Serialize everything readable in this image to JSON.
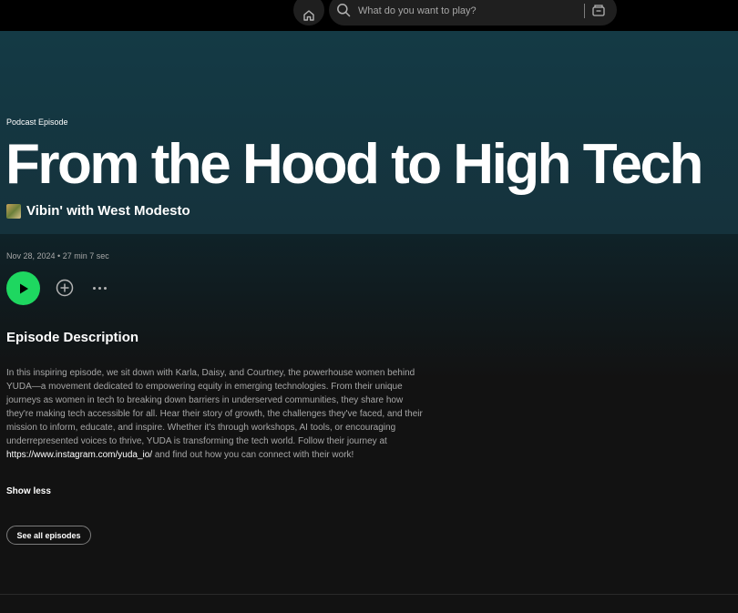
{
  "search": {
    "placeholder": "What do you want to play?"
  },
  "episode": {
    "type_label": "Podcast Episode",
    "title": "From the Hood to High Tech",
    "show_name": "Vibin' with West Modesto",
    "meta": "Nov 28, 2024 • 27 min 7 sec"
  },
  "description": {
    "heading": "Episode Description",
    "body": "In this inspiring episode, we sit down with Karla, Daisy, and Courtney, the powerhouse women behind YUDA—a movement dedicated to empowering equity in emerging technologies. From their unique journeys as women in tech to breaking down barriers in underserved communities, they share how they're making tech accessible for all. Hear their story of growth, the challenges they've faced, and their mission to inform, educate, and inspire. Whether it's through workshops, AI tools, or encouraging underrepresented voices to thrive, YUDA is transforming the tech world. Follow their journey at ",
    "link": "https://www.instagram.com/yuda_io/",
    "body_end": " and find out how you can connect with their work!",
    "show_less_label": "Show less"
  },
  "actions": {
    "see_all_label": "See all episodes"
  },
  "icons": {
    "home": "home-icon",
    "search": "search-icon",
    "browse": "browse-icon",
    "play": "play-icon",
    "add": "add-circle-icon",
    "more": "more-options-icon"
  },
  "colors": {
    "accent": "#1ed760",
    "hero": "#143a45",
    "background": "#121212"
  }
}
